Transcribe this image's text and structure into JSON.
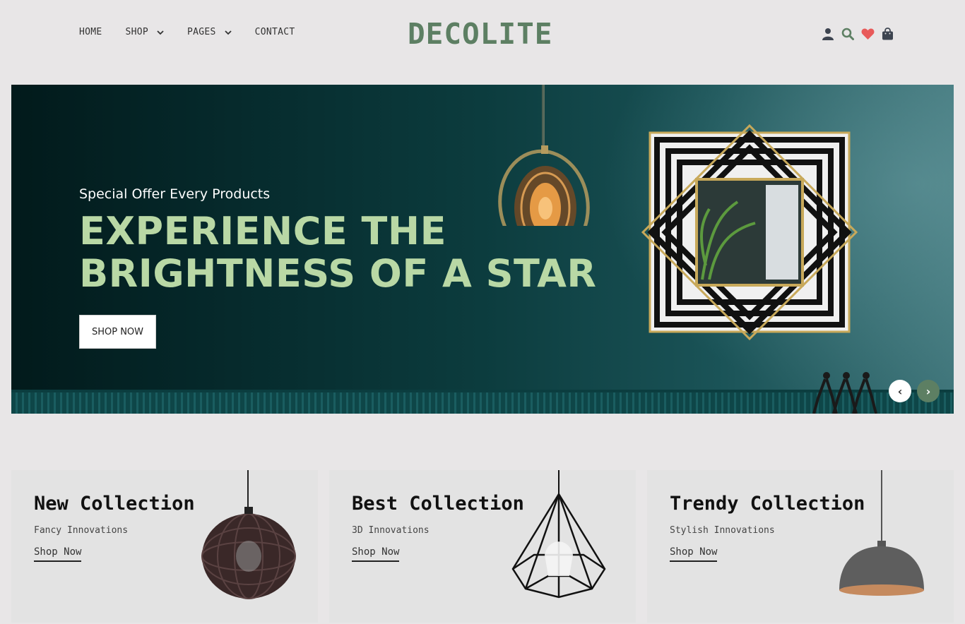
{
  "header": {
    "nav": [
      {
        "label": "HOME"
      },
      {
        "label": "SHOP"
      },
      {
        "label": "PAGES"
      },
      {
        "label": "CONTACT"
      }
    ],
    "logo": "DECOLITE",
    "icons": [
      "user-icon",
      "search-icon",
      "heart-icon",
      "bag-icon"
    ],
    "accent_color": "#5d7f63",
    "heart_color": "#e85a5a"
  },
  "hero": {
    "subtitle": "Special Offer Every Products",
    "title_line1": "EXPERIENCE THE",
    "title_line2": "BRIGHTNESS OF A STAR",
    "button": "SHOP NOW",
    "prev_arrow": "‹",
    "next_arrow": "›",
    "title_color": "#b9d8a5"
  },
  "collections": [
    {
      "title": "New Collection",
      "subtitle": "Fancy Innovations",
      "link": "Shop Now"
    },
    {
      "title": "Best Collection",
      "subtitle": "3D Innovations",
      "link": "Shop Now"
    },
    {
      "title": "Trendy Collection",
      "subtitle": "Stylish Innovations",
      "link": "Shop Now"
    }
  ]
}
